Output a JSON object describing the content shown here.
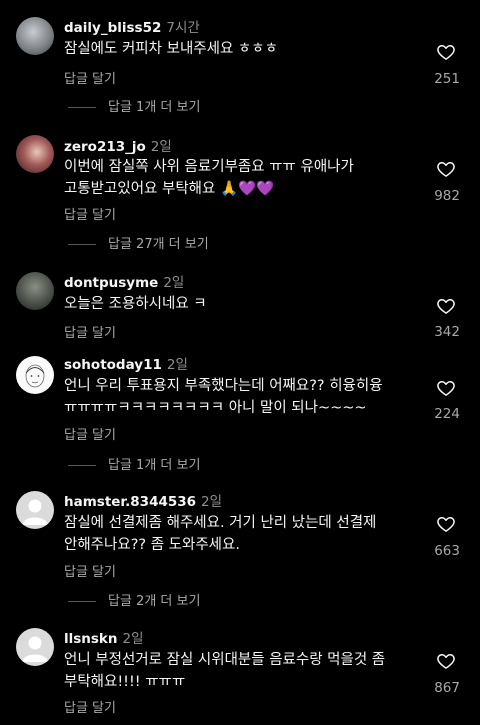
{
  "comments": [
    {
      "username": "daily_bliss52",
      "time": "7시간",
      "text": "잠실에도 커피차 보내주세요 ㅎㅎㅎ",
      "reply_label": "답글 달기",
      "view_replies": "답글 1개 더 보기",
      "likes": "251",
      "avatar": "photo-avatar"
    },
    {
      "username": "zero213_jo",
      "time": "2일",
      "text": "이번에 잠실쪽 사위 음료기부좀요 ㅠㅠ 유애나가 고통받고있어요 부탁해요 🙏💜💜",
      "reply_label": "답글 달기",
      "view_replies": "답글 27개 더 보기",
      "likes": "982",
      "avatar": "photo-avatar"
    },
    {
      "username": "dontpusyme",
      "time": "2일",
      "text": "오늘은 조용하시네요 ㅋ",
      "reply_label": "답글 달기",
      "likes": "342",
      "avatar": "photo-avatar"
    },
    {
      "username": "sohotoday11",
      "time": "2일",
      "text": "언니 우리 투표용지 부족했다는데 어째요?? 히융히융 ㅠㅠㅠㅠㅋㅋㅋㅋㅋㅋㅋㅋ 아니 말이 되나~~~~",
      "reply_label": "답글 달기",
      "view_replies": "답글 1개 더 보기",
      "likes": "224",
      "avatar": "sketch-avatar"
    },
    {
      "username": "hamster.8344536",
      "time": "2일",
      "text": "잠실에 선결제좀 해주세요. 거기 난리 났는데 선결제 안해주나요?? 좀 도와주세요.",
      "reply_label": "답글 달기",
      "view_replies": "답글 2개 더 보기",
      "likes": "663",
      "avatar": "default-avatar"
    },
    {
      "username": "llsnskn",
      "time": "2일",
      "text": "언니 부정선거로 잠실 시위대분들 음료수랑 먹을것 좀 부탁해요!!!! ㅠㅠㅠ",
      "reply_label": "답글 달기",
      "likes": "867",
      "avatar": "default-avatar"
    }
  ],
  "colors": {
    "background": "#000000",
    "primary_text": "#f5f5f5",
    "secondary_text": "#a8a8a8",
    "timestamp": "#8e8e8e"
  }
}
